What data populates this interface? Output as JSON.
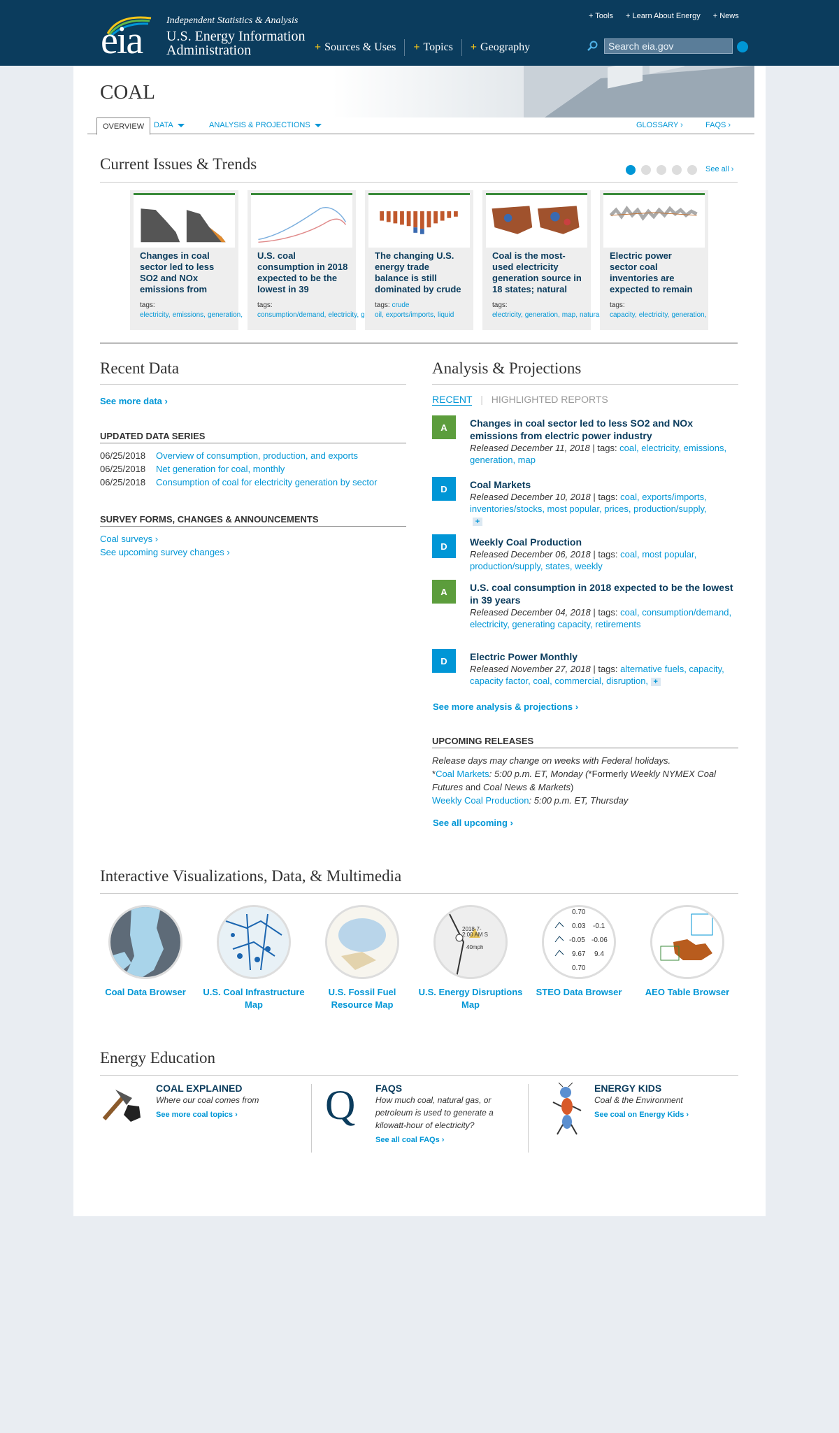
{
  "header": {
    "tagline": "Independent Statistics & Analysis",
    "org_line1": "U.S. Energy Information",
    "org_line2": "Administration",
    "logo_text": "eia",
    "nav": [
      "Sources & Uses",
      "Topics",
      "Geography"
    ],
    "utility": [
      "Tools",
      "Learn About Energy",
      "News"
    ],
    "search_placeholder": "Search eia.gov"
  },
  "page": {
    "title": "COAL",
    "tabs": {
      "overview": "OVERVIEW",
      "data": "DATA",
      "analysis": "ANALYSIS & PROJECTIONS",
      "glossary": "GLOSSARY ›",
      "faqs": "FAQS ›"
    }
  },
  "trends": {
    "heading": "Current Issues & Trends",
    "see_all": "See all ›",
    "cards": [
      {
        "caption": "Changes in coal sector led to less SO2 and NOx emissions from",
        "tags": [
          "electricity,",
          "emissions,",
          "generation,"
        ]
      },
      {
        "caption": "U.S. coal consumption in 2018 expected to be the lowest in 39",
        "tags": [
          "consumption/demand,",
          "electricity,",
          "generating"
        ]
      },
      {
        "caption": "The changing U.S. energy trade balance is still dominated by crude",
        "tags": [
          "crude oil,",
          "exports/imports,",
          "liquid"
        ]
      },
      {
        "caption": "Coal is the most-used electricity generation source in 18 states; natural",
        "tags": [
          "electricity,",
          "generation,",
          "map,",
          "natural"
        ]
      },
      {
        "caption": "Electric power sector coal inventories are expected to remain",
        "tags": [
          "capacity,",
          "electricity,",
          "generation,"
        ]
      }
    ],
    "tags_label": "tags:"
  },
  "recent": {
    "heading": "Recent Data",
    "see_more": "See more data ›",
    "updated_heading": "UPDATED DATA SERIES",
    "series": [
      {
        "date": "06/25/2018",
        "title": "Overview of consumption, production, and exports"
      },
      {
        "date": "06/25/2018",
        "title": "Net generation for coal, monthly"
      },
      {
        "date": "06/25/2018",
        "title": "Consumption of coal for electricity generation by sector"
      }
    ],
    "survey_heading": "SURVEY FORMS, CHANGES & ANNOUNCEMENTS",
    "survey_links": [
      "Coal surveys ›",
      "See upcoming survey changes ›"
    ]
  },
  "analysis": {
    "heading": "Analysis & Projections",
    "tab_recent": "RECENT",
    "tab_highlight": "HIGHLIGHTED REPORTS",
    "items": [
      {
        "badge": "A",
        "title": "Changes in coal sector led to less SO2 and NOx emissions from electric power industry",
        "released": "Released December 11, 2018",
        "tags": "coal, electricity, emissions, generation, map"
      },
      {
        "badge": "D",
        "title": "Coal Markets",
        "released": "Released December 10, 2018",
        "tags": "coal, exports/imports, inventories/stocks, most popular, prices, production/supply,"
      },
      {
        "badge": "D",
        "title": "Weekly Coal Production",
        "released": "Released December 06, 2018",
        "tags": "coal, most popular, production/supply, states, weekly"
      },
      {
        "badge": "A",
        "title": "U.S. coal consumption in 2018 expected to be the lowest in 39 years",
        "released": "Released December 04, 2018",
        "tags": "coal, consumption/demand, electricity, generating capacity, retirements"
      },
      {
        "badge": "D",
        "title": "Electric Power Monthly",
        "released": "Released November 27, 2018",
        "tags": "alternative fuels, capacity, capacity factor, coal, commercial, disruption,"
      }
    ],
    "tags_sep": " | tags: ",
    "plus": "+",
    "see_more": "See more analysis & projections ›",
    "upcoming_heading": "UPCOMING RELEASES",
    "note": "Release days may change on weeks with Federal holidays.",
    "coal_markets": "Coal Markets",
    "coal_markets_time": ": 5:00 p.m. ET, Monday (",
    "formerly": "*Formerly ",
    "wnymex": "Weekly NYMEX Coal Futures",
    "and": " and ",
    "cnm": "Coal News & Markets",
    "close": ")",
    "wcp": "Weekly Coal Production",
    "wcp_time": ": 5:00 p.m. ET, Thursday",
    "see_upcoming": "See all upcoming ›"
  },
  "viz": {
    "heading": "Interactive Visualizations, Data, & Multimedia",
    "items": [
      "Coal Data Browser",
      "U.S. Coal Infrastructure Map",
      "U.S. Fossil Fuel Resource Map",
      "U.S. Energy Disruptions Map",
      "STEO Data Browser",
      "AEO Table Browser"
    ],
    "steo_vals": [
      [
        "0.70",
        ""
      ],
      [
        "0.03",
        "-0.1"
      ],
      [
        "-0.05",
        "-0.06"
      ],
      [
        "9.67",
        "9.4"
      ],
      [
        "0.70",
        ""
      ]
    ],
    "map_text": [
      "2018-7-",
      "2:00 AM S",
      "40mph"
    ]
  },
  "education": {
    "heading": "Energy Education",
    "blocks": [
      {
        "title": "COAL EXPLAINED",
        "desc": "Where our coal comes from",
        "more": "See more coal topics ›"
      },
      {
        "title": "FAQS",
        "desc": "How much coal, natural gas, or petroleum is used to generate a kilowatt-hour of electricity?",
        "more": "See all coal FAQs ›"
      },
      {
        "title": "ENERGY KIDS",
        "desc": "Coal & the Environment",
        "more": "See coal on Energy Kids ›"
      }
    ],
    "faq_glyph": "Q"
  },
  "colors": {
    "header": "#0b3c5d",
    "accent": "#0096d6",
    "analysis_badge": "#5c9d3c"
  }
}
